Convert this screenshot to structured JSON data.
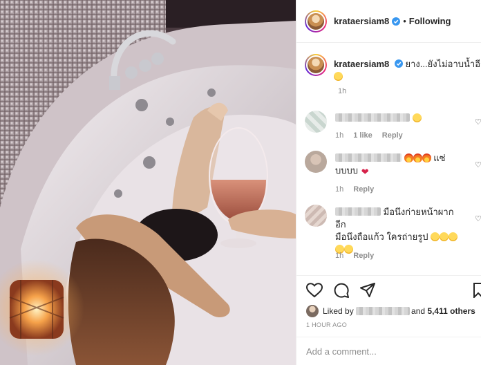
{
  "post": {
    "username": "krataersiam8",
    "follow_status": "Following",
    "separator": "•"
  },
  "caption": {
    "username": "krataersiam8",
    "text": "ยาง...ยังไม่อาบน้ำอีก",
    "time": "1h"
  },
  "comments": [
    {
      "text": "",
      "time": "1h",
      "likes": "1 like",
      "reply": "Reply"
    },
    {
      "text_line1": "แซ่",
      "text_line2": "บบบบ",
      "time": "1h",
      "reply": "Reply"
    },
    {
      "text_line1": "มือนึงก่ายหน้าผาก อีก",
      "text_line2": "มือนึงถือแก้ว ใครถ่ายรูป",
      "time": "1h",
      "reply": "Reply"
    }
  ],
  "likes": {
    "prefix": "Liked by",
    "suffix": "and",
    "count_text": "5,411 others"
  },
  "time_ago": "1 HOUR AGO",
  "add_comment_placeholder": "Add a comment...",
  "icons": {
    "like": "heart-icon",
    "comment": "comment-icon",
    "share": "share-icon",
    "save": "bookmark-icon",
    "verified": "verified-badge-icon"
  },
  "colors": {
    "verified": "#3897f0",
    "secondary_text": "#8e8e8e",
    "primary_text": "#262626"
  }
}
